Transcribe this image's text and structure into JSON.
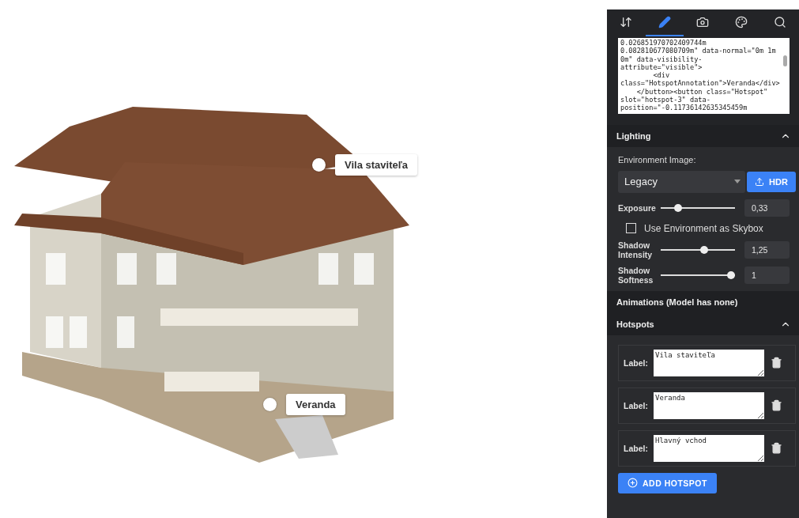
{
  "viewer": {
    "hotspots": [
      {
        "label": "Vila staviteľa"
      },
      {
        "label": "Veranda"
      }
    ]
  },
  "toolbar": {
    "tabs": [
      {
        "kind": "transform",
        "selected": false
      },
      {
        "kind": "edit",
        "selected": true
      },
      {
        "kind": "camera",
        "selected": false
      },
      {
        "kind": "palette",
        "selected": false
      },
      {
        "kind": "search",
        "selected": false
      }
    ]
  },
  "code_text": "0.026851970702409744m\n0.082810677080709m\" data-normal=\"0m 1m\n0m\" data-visibility-\nattribute=\"visible\">\n        <div\nclass=\"HotspotAnnotation\">Veranda</div>\n    </button><button class=\"Hotspot\"\nslot=\"hotspot-3\" data-\nposition=\"-0.11736142635345459m",
  "lighting": {
    "title": "Lighting",
    "expanded": true,
    "environment_label": "Environment Image:",
    "environment_value": "Legacy",
    "hdr_button": "HDR",
    "exposure": {
      "label": "Exposure",
      "level": 0.2,
      "value": "0,33"
    },
    "skybox": {
      "label": "Use Environment as Skybox",
      "checked": false
    },
    "shadow_intensity": {
      "label": "Shadow Intensity",
      "level": 0.6,
      "value": "1,25"
    },
    "shadow_softness": {
      "label": "Shadow Softness",
      "level": 1,
      "value": "1"
    }
  },
  "animations": {
    "title": "Animations (Model has none)"
  },
  "hotspots_panel": {
    "title": "Hotspots",
    "expanded": true,
    "items": [
      {
        "label": "Label:",
        "value": "Vila staviteľa"
      },
      {
        "label": "Label:",
        "value": "Veranda"
      },
      {
        "label": "Label:",
        "value": "Hlavný vchod"
      }
    ],
    "add_button": "ADD HOTSPOT"
  }
}
